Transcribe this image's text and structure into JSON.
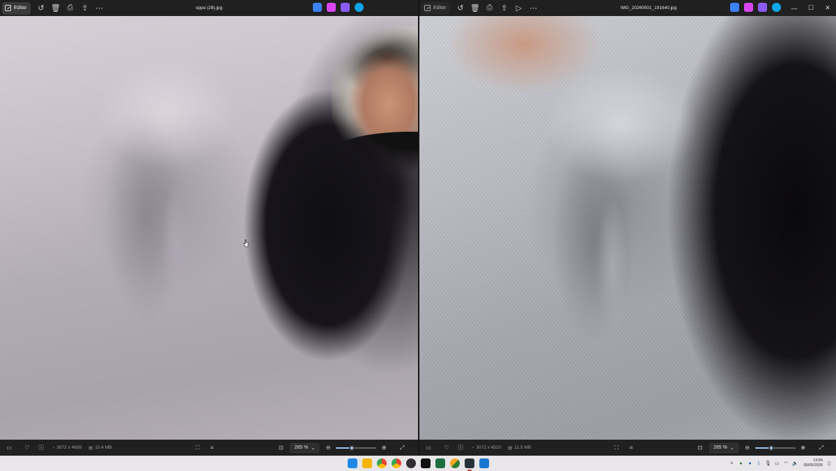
{
  "left_window": {
    "edit_label": "Editar",
    "filename": "oppo (28).jpg",
    "dimensions": "3072 x 4608",
    "file_size": "10.4 MB",
    "zoom": "285 %",
    "zoom_level": 0.4
  },
  "right_window": {
    "edit_label": "Editar",
    "filename": "IMG_20260501_191640.jpg",
    "dimensions": "3072 x 4520",
    "file_size": "11.5 MB",
    "zoom": "285 %",
    "zoom_level": 0.4
  },
  "toolbar_icons": [
    "rotate-icon",
    "delete-icon",
    "print-icon",
    "share-icon",
    "more-icon"
  ],
  "app_icon_colors": [
    "#3b82f6",
    "#d946ef",
    "#8b5cf6",
    "#0ea5e9"
  ],
  "taskbar": {
    "apps": [
      {
        "name": "windows-start-icon",
        "color": "#1e88e5"
      },
      {
        "name": "file-explorer-icon",
        "color": "#f4b400"
      },
      {
        "name": "chrome-icon",
        "color": "#34a853"
      },
      {
        "name": "chrome-alt-icon",
        "color": "#ea4335"
      },
      {
        "name": "obs-icon",
        "color": "#302e31"
      },
      {
        "name": "capcut-icon",
        "color": "#111111"
      },
      {
        "name": "excel-icon",
        "color": "#1d6f42"
      },
      {
        "name": "app-green-icon",
        "color": "#2e7d32"
      },
      {
        "name": "photos-icon",
        "color": "#263238"
      },
      {
        "name": "photos-viewer-icon",
        "color": "#1976d2"
      }
    ],
    "time": "13:55",
    "date": "05/05/2026"
  }
}
